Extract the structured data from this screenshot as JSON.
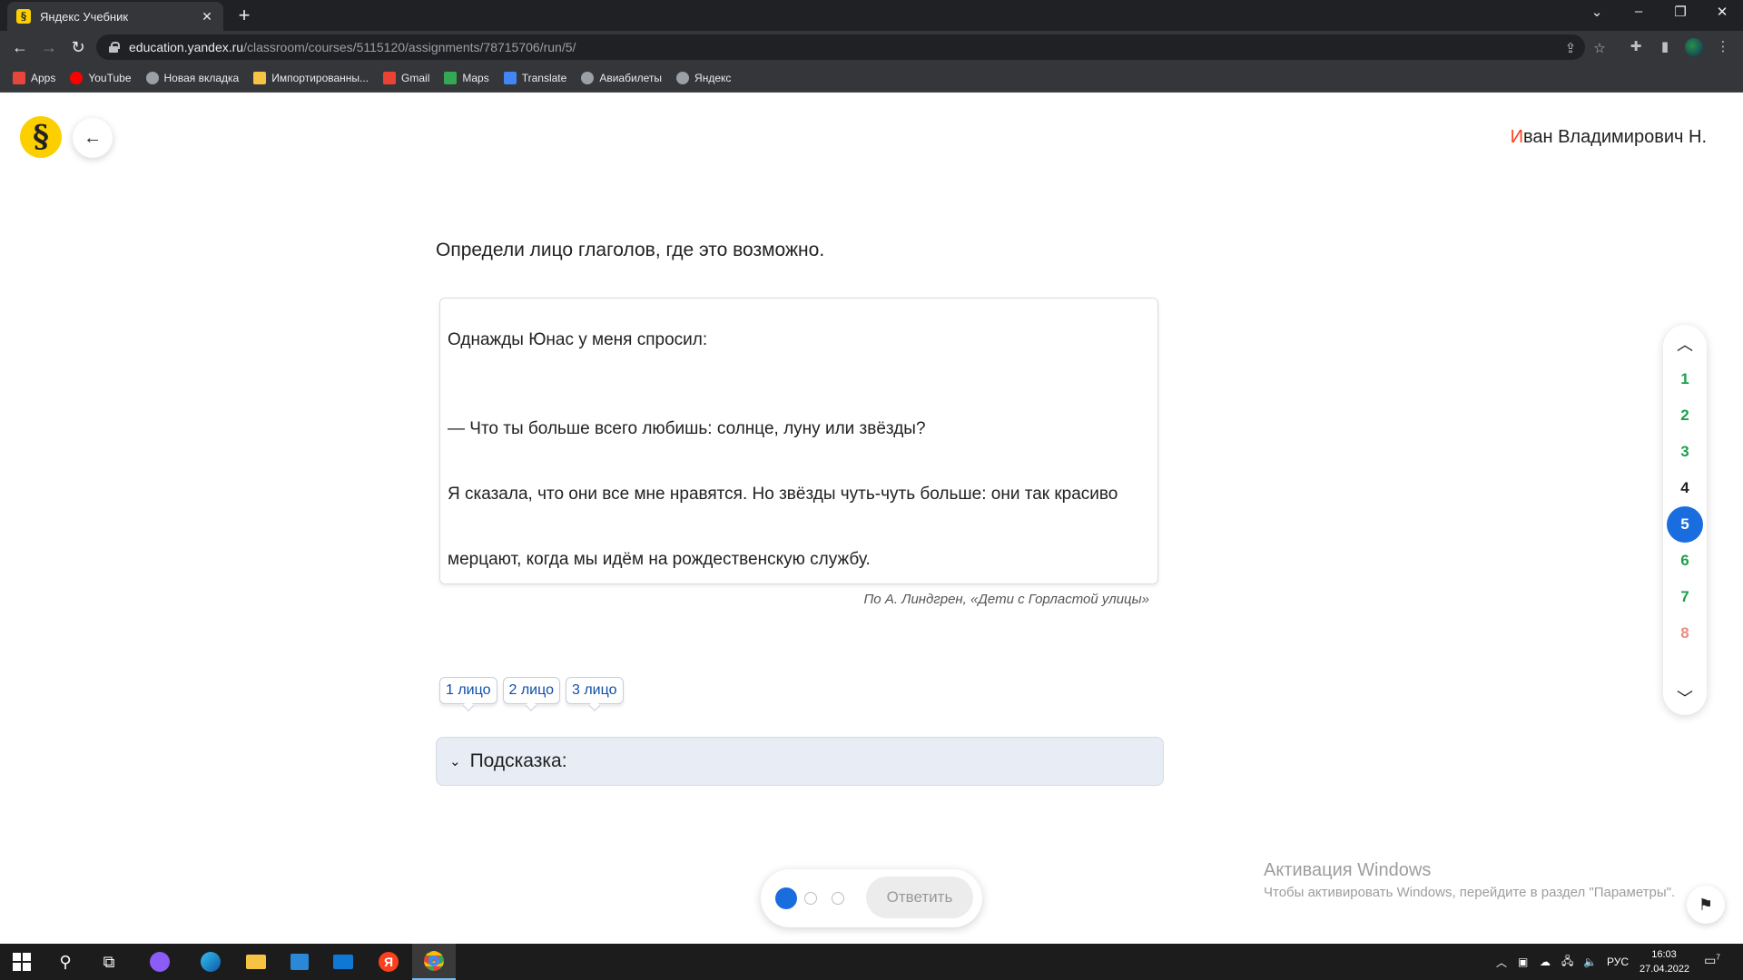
{
  "browser": {
    "tab_title": "Яндекс Учебник",
    "tab_favicon": "§",
    "url_host": "education.yandex.ru",
    "url_path": "/classroom/courses/5115120/assignments/78715706/run/5/",
    "bookmarks": [
      {
        "label": "Apps",
        "icon": "apps-grid-icon",
        "color": "#e8453c"
      },
      {
        "label": "YouTube",
        "icon": "youtube-icon",
        "color": "#ff0000"
      },
      {
        "label": "Новая вкладка",
        "icon": "globe-icon",
        "color": "#9aa0a6"
      },
      {
        "label": "Импортированны...",
        "icon": "folder-icon",
        "color": "#f6c342"
      },
      {
        "label": "Gmail",
        "icon": "gmail-icon",
        "color": "#ea4335"
      },
      {
        "label": "Maps",
        "icon": "maps-icon",
        "color": "#34a853"
      },
      {
        "label": "Translate",
        "icon": "translate-icon",
        "color": "#4285f4"
      },
      {
        "label": "Авиабилеты",
        "icon": "globe-icon",
        "color": "#9aa0a6"
      },
      {
        "label": "Яндекс",
        "icon": "globe-icon",
        "color": "#9aa0a6"
      }
    ]
  },
  "header": {
    "logo_glyph": "§",
    "user_name_first": "И",
    "user_name_rest": "ван Владимирович Н."
  },
  "task": {
    "title": "Определи лицо глаголов, где это возможно.",
    "text_lines": [
      "Однажды Юнас у меня спросил:",
      "— Что ты больше всего любишь: солнце, луну или звёзды?",
      "Я сказала, что они все мне нравятся. Но звёзды чуть-чуть больше: они так красиво",
      "мерцают, когда мы идём на рождественскую службу."
    ],
    "source": "По А. Линдгрен, «Дети с Горластой улицы»",
    "answer_tags": [
      "1 лицо",
      "2 лицо",
      "3 лицо"
    ],
    "hint_label": "Подсказка:"
  },
  "task_nav": {
    "items": [
      {
        "label": "1",
        "state": "done"
      },
      {
        "label": "2",
        "state": "done"
      },
      {
        "label": "3",
        "state": "done"
      },
      {
        "label": "4",
        "state": "neutral"
      },
      {
        "label": "5",
        "state": "current"
      },
      {
        "label": "6",
        "state": "done"
      },
      {
        "label": "7",
        "state": "done"
      },
      {
        "label": "8",
        "state": "wrong"
      }
    ]
  },
  "answer_bar": {
    "attempts_total": 3,
    "attempts_active": 1,
    "submit_label": "Ответить"
  },
  "watermark": {
    "title": "Активация Windows",
    "subtitle": "Чтобы активировать Windows, перейдите в раздел \"Параметры\"."
  },
  "taskbar": {
    "language": "РУС",
    "time": "16:03",
    "date": "27.04.2022",
    "yandex_glyph": "Я",
    "notification_count": "7"
  },
  "colors": {
    "accent_blue": "#1a6ddf",
    "done_green": "#1aa149",
    "wrong_red": "#e98b83",
    "yandex_yellow": "#fcd000",
    "yandex_red": "#fc3f1d"
  }
}
